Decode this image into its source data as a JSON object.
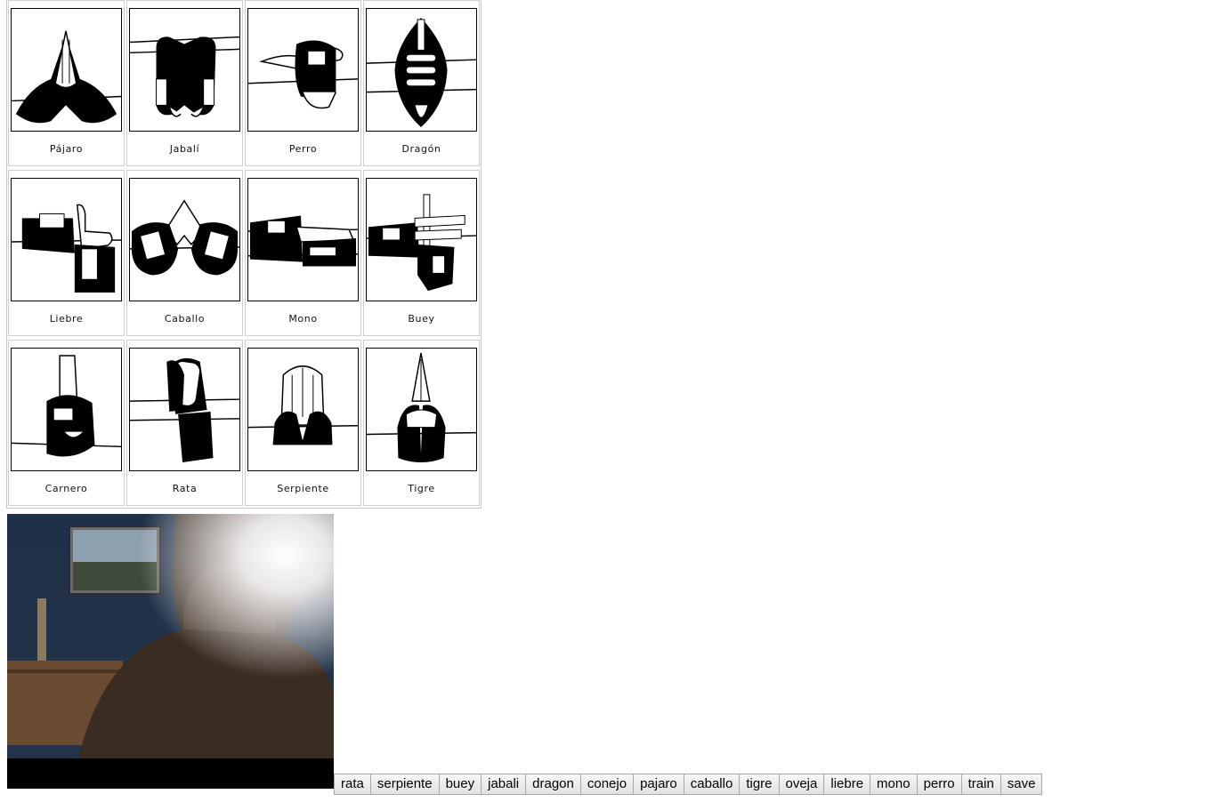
{
  "hand_signs": {
    "cards": [
      {
        "label": "Pájaro"
      },
      {
        "label": "Jabalí"
      },
      {
        "label": "Perro"
      },
      {
        "label": "Dragón"
      },
      {
        "label": "Liebre"
      },
      {
        "label": "Caballo"
      },
      {
        "label": "Mono"
      },
      {
        "label": "Buey"
      },
      {
        "label": "Carnero"
      },
      {
        "label": "Rata"
      },
      {
        "label": "Serpiente"
      },
      {
        "label": "Tigre"
      }
    ]
  },
  "toolbar": {
    "buttons": [
      {
        "label": "rata"
      },
      {
        "label": "serpiente"
      },
      {
        "label": "buey"
      },
      {
        "label": "jabali"
      },
      {
        "label": "dragon"
      },
      {
        "label": "conejo"
      },
      {
        "label": "pajaro"
      },
      {
        "label": "caballo"
      },
      {
        "label": "tigre"
      },
      {
        "label": "oveja"
      },
      {
        "label": "liebre"
      },
      {
        "label": "mono"
      },
      {
        "label": "perro"
      },
      {
        "label": "train"
      },
      {
        "label": "save"
      }
    ]
  }
}
